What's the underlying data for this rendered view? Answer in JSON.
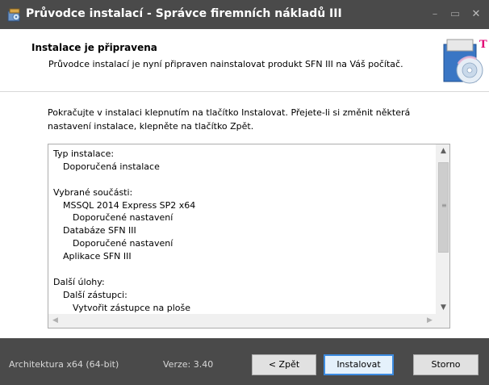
{
  "window": {
    "title": "Průvodce instalací - Správce firemních nákladů III",
    "controls": {
      "minimize": "–",
      "maximize": "▭",
      "close": "✕"
    },
    "app_icon": "installer-icon"
  },
  "header": {
    "title": "Instalace je připravena",
    "subtitle": "Průvodce instalací je nyní připraven nainstalovat produkt SFN III na Váš počítač.",
    "logo": "telekom-cd-logo",
    "logo_letter": "T"
  },
  "content": {
    "intro_line1": "Pokračujte v instalaci klepnutím na tlačítko Instalovat. Přejete-li si změnit některá",
    "intro_line2": "nastavení instalace, klepněte na tlačítko Zpět.",
    "memo_lines": [
      {
        "text": "Typ instalace:",
        "indent": 0
      },
      {
        "text": "Doporučená instalace",
        "indent": 1
      },
      {
        "text": "",
        "indent": 0
      },
      {
        "text": "Vybrané součásti:",
        "indent": 0
      },
      {
        "text": "MSSQL 2014 Express SP2 x64",
        "indent": 1
      },
      {
        "text": "Doporučené nastavení",
        "indent": 2
      },
      {
        "text": "Databáze SFN III",
        "indent": 1
      },
      {
        "text": "Doporučené nastavení",
        "indent": 2
      },
      {
        "text": "Aplikace SFN III",
        "indent": 1
      },
      {
        "text": "",
        "indent": 0
      },
      {
        "text": "Další úlohy:",
        "indent": 0
      },
      {
        "text": "Další zástupci:",
        "indent": 1
      },
      {
        "text": "Vytvořit zástupce na ploše",
        "indent": 2
      }
    ]
  },
  "footer": {
    "architecture": "Architektura x64 (64-bit)",
    "version": "Verze: 3.40",
    "back_button": "< Zpět",
    "install_button": "Instalovat",
    "cancel_button": "Storno"
  },
  "colors": {
    "titlebar": "#4a4a4a",
    "footer": "#4a4a4a",
    "accent": "#3c8be0",
    "brand_magenta": "#e20074"
  }
}
